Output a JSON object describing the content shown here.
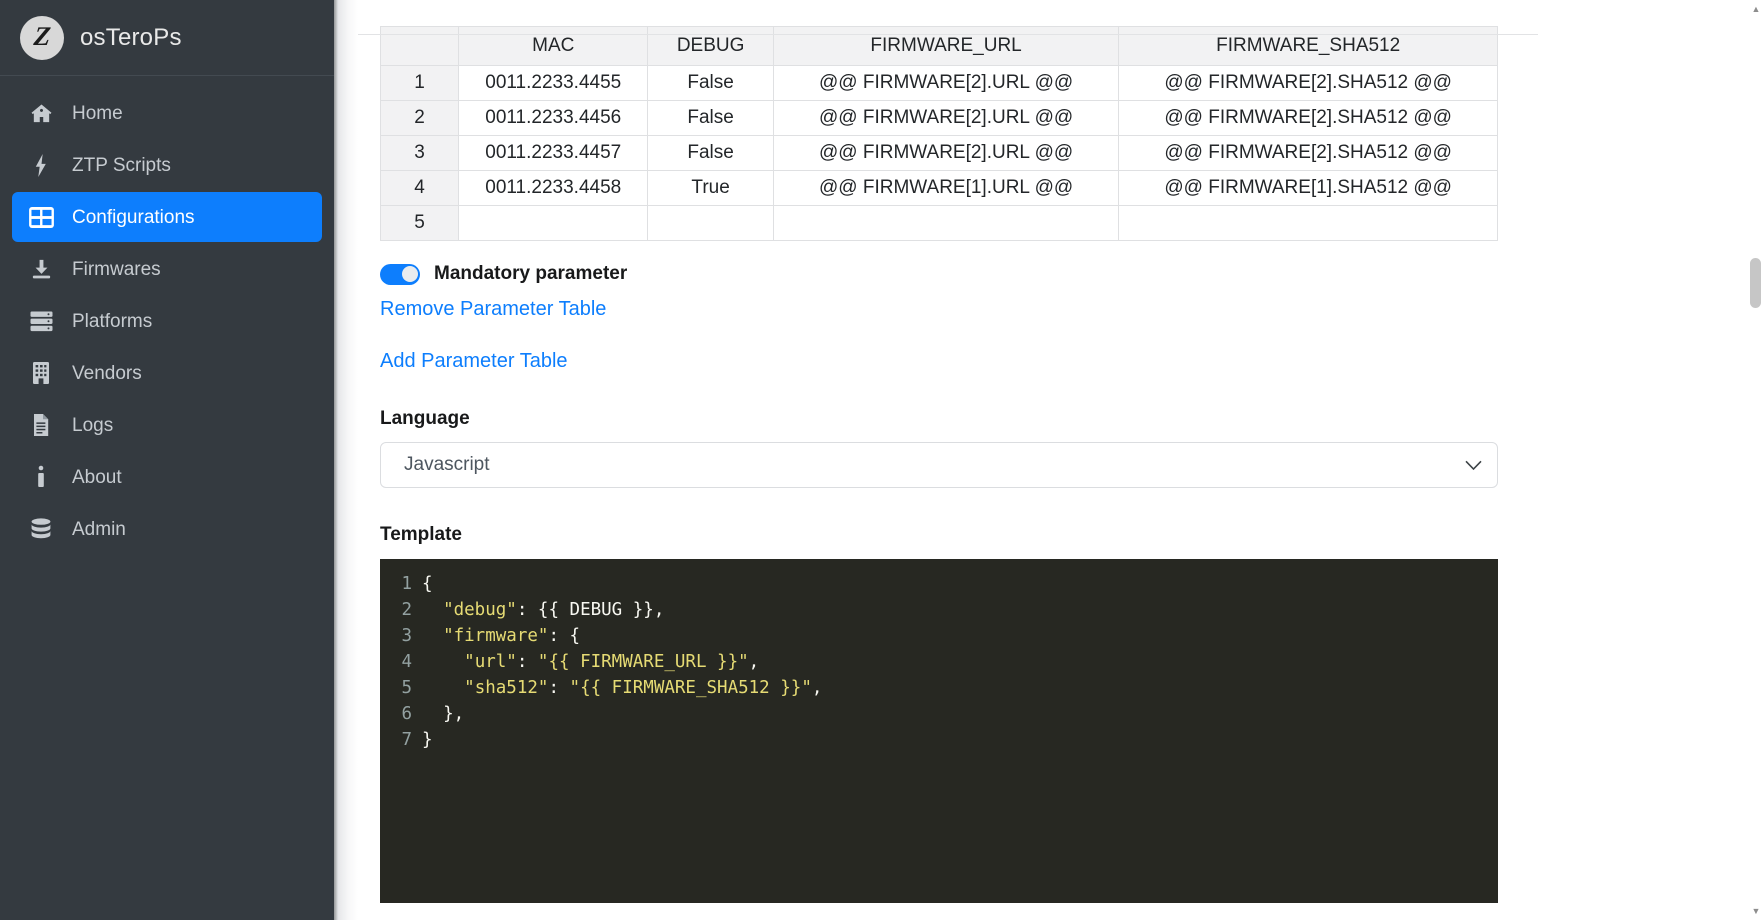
{
  "app": {
    "brand_mark": "Z",
    "brand_title": "osTeroPs"
  },
  "sidebar": {
    "items": [
      {
        "label": "Home",
        "icon": "home-icon",
        "active": false
      },
      {
        "label": "ZTP Scripts",
        "icon": "bolt-icon",
        "active": false
      },
      {
        "label": "Configurations",
        "icon": "table-icon",
        "active": true
      },
      {
        "label": "Firmwares",
        "icon": "download-icon",
        "active": false
      },
      {
        "label": "Platforms",
        "icon": "server-stack-icon",
        "active": false
      },
      {
        "label": "Vendors",
        "icon": "building-icon",
        "active": false
      },
      {
        "label": "Logs",
        "icon": "document-lines-icon",
        "active": false
      },
      {
        "label": "About",
        "icon": "info-icon",
        "active": false
      },
      {
        "label": "Admin",
        "icon": "database-icon",
        "active": false
      }
    ]
  },
  "parameter_table": {
    "headers": [
      "",
      "MAC",
      "DEBUG",
      "FIRMWARE_URL",
      "FIRMWARE_SHA512"
    ],
    "rows": [
      {
        "index": "1",
        "mac": "0011.2233.4455",
        "debug": "False",
        "firmware_url": "@@ FIRMWARE[2].URL @@",
        "firmware_sha512": "@@ FIRMWARE[2].SHA512 @@"
      },
      {
        "index": "2",
        "mac": "0011.2233.4456",
        "debug": "False",
        "firmware_url": "@@ FIRMWARE[2].URL @@",
        "firmware_sha512": "@@ FIRMWARE[2].SHA512 @@"
      },
      {
        "index": "3",
        "mac": "0011.2233.4457",
        "debug": "False",
        "firmware_url": "@@ FIRMWARE[2].URL @@",
        "firmware_sha512": "@@ FIRMWARE[2].SHA512 @@"
      },
      {
        "index": "4",
        "mac": "0011.2233.4458",
        "debug": "True",
        "firmware_url": "@@ FIRMWARE[1].URL @@",
        "firmware_sha512": "@@ FIRMWARE[1].SHA512 @@"
      },
      {
        "index": "5",
        "mac": "",
        "debug": "",
        "firmware_url": "",
        "firmware_sha512": ""
      }
    ]
  },
  "controls": {
    "mandatory_toggle_label": "Mandatory parameter",
    "mandatory_toggle_on": true,
    "remove_table_link": "Remove Parameter Table",
    "add_table_link": "Add Parameter Table"
  },
  "language_field": {
    "label": "Language",
    "value": "Javascript"
  },
  "template_field": {
    "label": "Template",
    "lines": [
      {
        "n": "1",
        "tokens": [
          {
            "t": "{",
            "c": "punc"
          }
        ]
      },
      {
        "n": "2",
        "tokens": [
          {
            "t": "  ",
            "c": "punc"
          },
          {
            "t": "\"debug\"",
            "c": "str"
          },
          {
            "t": ": {{ ",
            "c": "punc"
          },
          {
            "t": "DEBUG",
            "c": "var"
          },
          {
            "t": " }},",
            "c": "punc"
          }
        ]
      },
      {
        "n": "3",
        "tokens": [
          {
            "t": "  ",
            "c": "punc"
          },
          {
            "t": "\"firmware\"",
            "c": "str"
          },
          {
            "t": ": {",
            "c": "punc"
          }
        ]
      },
      {
        "n": "4",
        "tokens": [
          {
            "t": "    ",
            "c": "punc"
          },
          {
            "t": "\"url\"",
            "c": "str"
          },
          {
            "t": ": ",
            "c": "punc"
          },
          {
            "t": "\"{{ FIRMWARE_URL }}\"",
            "c": "str"
          },
          {
            "t": ",",
            "c": "punc"
          }
        ]
      },
      {
        "n": "5",
        "tokens": [
          {
            "t": "    ",
            "c": "punc"
          },
          {
            "t": "\"sha512\"",
            "c": "str"
          },
          {
            "t": ": ",
            "c": "punc"
          },
          {
            "t": "\"{{ FIRMWARE_SHA512 }}\"",
            "c": "str"
          },
          {
            "t": ",",
            "c": "punc"
          }
        ]
      },
      {
        "n": "6",
        "tokens": [
          {
            "t": "  },",
            "c": "punc"
          }
        ]
      },
      {
        "n": "7",
        "tokens": [
          {
            "t": "}",
            "c": "punc"
          }
        ]
      }
    ]
  },
  "colors": {
    "accent": "#0d7efd",
    "sidebar_bg": "#343a40",
    "editor_bg": "#272822",
    "code_string": "#e6db74",
    "link": "#0d7efd"
  },
  "scrollbar": {
    "up_arrow": "▲",
    "down_arrow": "▼"
  }
}
